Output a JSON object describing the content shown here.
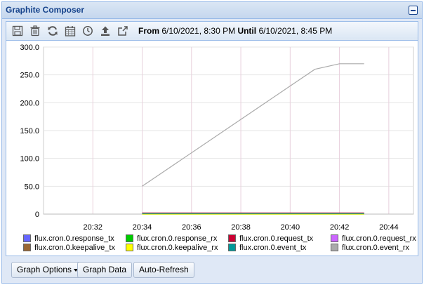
{
  "window": {
    "title": "Graphite Composer"
  },
  "toolbar": {
    "icons": [
      "save-icon",
      "trash-icon",
      "refresh-icon",
      "calendar-icon",
      "clock-icon",
      "upload-icon",
      "share-icon"
    ],
    "from_label": "From",
    "from_value": "6/10/2021, 8:30 PM",
    "until_label": "Until",
    "until_value": "6/10/2021, 8:45 PM"
  },
  "chart_data": {
    "type": "line",
    "x_ticks": [
      "20:32",
      "20:34",
      "20:36",
      "20:38",
      "20:40",
      "20:42",
      "20:44"
    ],
    "y_ticks": [
      "300.0",
      "250.0",
      "200.0",
      "150.0",
      "100.0",
      "50.0",
      "0"
    ],
    "xlim": [
      "20:30",
      "20:45"
    ],
    "ylim": [
      0,
      300
    ],
    "grid": true,
    "legend_position": "bottom",
    "series": [
      {
        "name": "flux.cron.0.response_tx",
        "color": "#6666ff",
        "x": [
          "20:34",
          "20:43"
        ],
        "y": [
          0,
          0
        ]
      },
      {
        "name": "flux.cron.0.response_rx",
        "color": "#00cc00",
        "x": [
          "20:34",
          "20:43"
        ],
        "y": [
          0,
          0
        ]
      },
      {
        "name": "flux.cron.0.request_tx",
        "color": "#cc0033",
        "x": [
          "20:34",
          "20:43"
        ],
        "y": [
          2,
          2
        ]
      },
      {
        "name": "flux.cron.0.request_rx",
        "color": "#cc66ff",
        "x": [
          "20:34",
          "20:43"
        ],
        "y": [
          1,
          1
        ]
      },
      {
        "name": "flux.cron.0.keepalive_tx",
        "color": "#996633",
        "x": [
          "20:34",
          "20:43"
        ],
        "y": [
          1,
          1
        ]
      },
      {
        "name": "flux.cron.0.keepalive_rx",
        "color": "#ffff00",
        "x": [
          "20:34",
          "20:43"
        ],
        "y": [
          0,
          0
        ]
      },
      {
        "name": "flux.cron.0.event_tx",
        "color": "#009999",
        "x": [
          "20:34",
          "20:43"
        ],
        "y": [
          1,
          1
        ]
      },
      {
        "name": "flux.cron.0.event_rx",
        "color": "#aaaaaa",
        "x": [
          "20:34",
          "20:41",
          "20:42",
          "20:43"
        ],
        "y": [
          50,
          260,
          270,
          270
        ]
      }
    ]
  },
  "footer": {
    "graph_options_label": "Graph Options",
    "graph_data_label": "Graph Data",
    "auto_refresh_label": "Auto-Refresh"
  }
}
